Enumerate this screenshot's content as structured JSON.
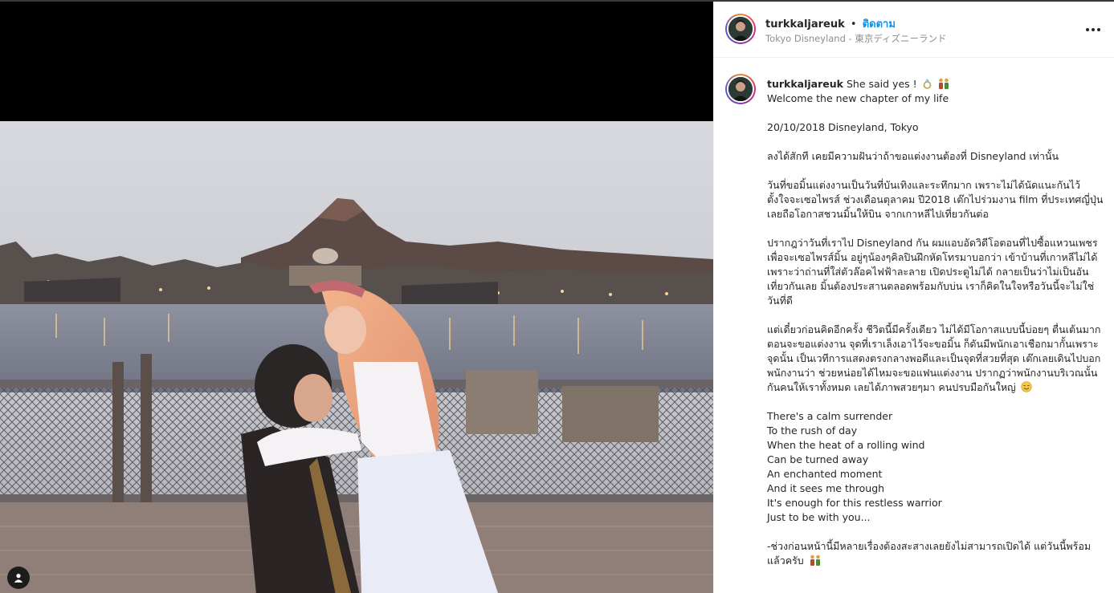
{
  "post": {
    "username": "turkkaljareuk",
    "separator": "•",
    "follow_label": "ติดตาม",
    "location": "Tokyo Disneyland - 東京ディズニーランド"
  },
  "icons": {
    "more": "more-options-icon",
    "tag": "user-tag-icon",
    "ring": "ring-emoji-icon",
    "couple": "couple-emoji-icon",
    "smile": "smile-emoji-icon"
  },
  "colors": {
    "follow": "#0095f6",
    "text": "#262626",
    "secondary": "#8e8e8e"
  },
  "caption": {
    "first_text": "She said yes !",
    "lines": [
      "Welcome the new chapter of my life",
      "",
      "20/10/2018 Disneyland, Tokyo",
      "",
      "ลงได้สักที เคยมีความฝันว่าถ้าขอแต่งงานต้องที่ Disneyland เท่านั้น",
      "",
      "วันที่ขอมิ้นแต่งงานเป็นวันที่บันเทิงและระทึกมาก เพราะไม่ได้นัดแนะกันไว้ ตั้งใจจะเซอไพรส์ ช่วงเดือนตุลาคม ปี2018 เต๊กไปร่วมงาน film ที่ประเทศญี่ปุ่น เลยถือโอกาสชวนมิ้นให้บิน จากเกาหลีไปเที่ยวกันต่อ",
      "",
      "ปรากฎว่าวันที่เราไป Disneyland กัน ผมแอบอัดวิดีโอตอนที่ไปซื้อแหวนเพชร เพื่อจะเซอไพรส์มิ้น อยู่ๆน้องๆคิลปินฝึกหัดโทรมาบอกว่า เข้าบ้านที่เกาหลีไม่ได้เพราะว่าถ่านที่ใส่ตัวล๊อคไฟฟ้าละลาย เปิดประตูไม่ได้ กลายเป็นว่าไม่เป็นอันเที่ยวกันเลย มิ้นต้องประสานตลอดพร้อมกับบ่น เราก็คิดในใจหรือวันนี้จะไม่ใช่วันที่ดี",
      "",
      "แต่เดี๋ยวก่อนคิดอีกครั้ง ชีวิตนี้มีครั้งเดียว ไม่ได้มีโอกาสแบบนี้บ่อยๆ ตื่นเต้นมากตอนจะขอแต่งงาน จุดที่เราเล็งเอาไว้จะขอมิ้น ก็ดันมีพนักเอาเชือกมากั้นเพราะจุดนั้น เป็นเวทีการแสดงตรงกลางพอดีและเป็นจุดที่สวยที่สุด เต๊กเลยเดินไปบอกพนักงานว่า ช่วยหน่อยได้ไหมจะขอแฟนแต่งงาน ปรากฏว่าพนักงานบริเวณนั้นกันคนให้เราทั้งหมด เลยได้ภาพสวยๆมา คนปรบมือกันใหญ่",
      "",
      "There's a calm surrender",
      "To the rush of day",
      "When the heat of a rolling wind",
      "Can be turned away",
      "An enchanted moment",
      "And it sees me through",
      "It's enough for this restless warrior",
      "Just to be with you...",
      "",
      "-ช่วงก่อนหน้านี้มีหลายเรื่องต้องสะสางเลยยังไม่สามารถเปิดได้ แต่วันนี้พร้อมแล้วครับ"
    ]
  }
}
